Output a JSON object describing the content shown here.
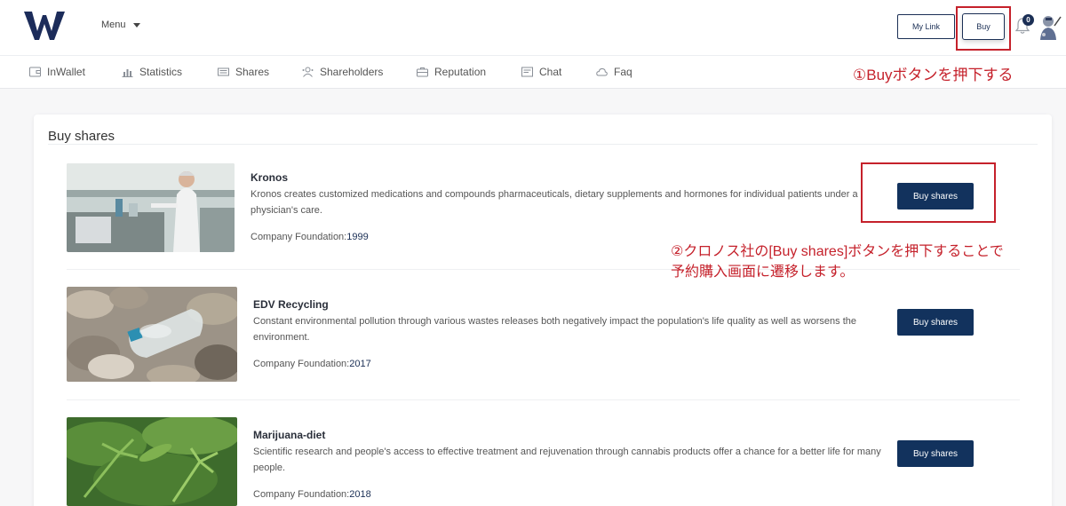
{
  "header": {
    "logo_letter": "W",
    "menu_label": "Menu",
    "mylink_label": "My Link",
    "buy_label": "Buy",
    "notification_count": "0"
  },
  "nav": {
    "items": [
      {
        "label": "InWallet",
        "icon": "wallet-icon"
      },
      {
        "label": "Statistics",
        "icon": "bar-chart-icon"
      },
      {
        "label": "Shares",
        "icon": "shares-icon"
      },
      {
        "label": "Shareholders",
        "icon": "shareholders-icon"
      },
      {
        "label": "Reputation",
        "icon": "briefcase-icon"
      },
      {
        "label": "Chat",
        "icon": "chat-icon"
      },
      {
        "label": "Faq",
        "icon": "cloud-icon"
      }
    ]
  },
  "annotations": {
    "step1": "①Buyボタンを押下する",
    "step2_line1": "②クロノス社の[Buy shares]ボタンを押下することで",
    "step2_line2": "予約購入画面に遷移します。",
    "color": "#c5212b"
  },
  "main": {
    "title": "Buy shares",
    "companies": [
      {
        "name": "Kronos",
        "description": "Kronos creates customized medications and compounds pharmaceuticals, dietary supplements and hormones for individual patients under a physician's care.",
        "foundation_label": "Company Foundation:",
        "foundation_year": "1999",
        "button_label": "Buy shares",
        "image": "laboratory-scientist-photo"
      },
      {
        "name": "EDV Recycling",
        "description": "Constant environmental pollution through various wastes releases both negatively impact the population's life quality as well as worsens the environment.",
        "foundation_label": "Company Foundation:",
        "foundation_year": "2017",
        "button_label": "Buy shares",
        "image": "pebbles-plastic-bottle-photo"
      },
      {
        "name": "Marijuana-diet",
        "description": "Scientific research and people's access to effective treatment and rejuvenation through cannabis products offer a chance for a better life for many people.",
        "foundation_label": "Company Foundation:",
        "foundation_year": "2018",
        "button_label": "Buy shares",
        "image": "cannabis-plant-photo"
      }
    ]
  },
  "colors": {
    "primary": "#12325d",
    "annotation_red": "#c5212b"
  }
}
